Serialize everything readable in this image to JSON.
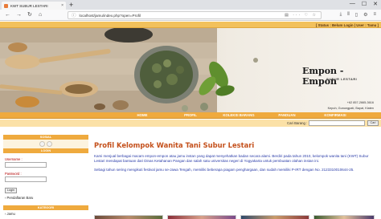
{
  "browser": {
    "tab_title": "KWT SUBUR LESTARI",
    "url": "localhost/jamu/index.php?open=Profil",
    "tab_close": "×",
    "new_tab": "+",
    "win_min": "—",
    "win_max": "☐",
    "win_close": "✕"
  },
  "site": {
    "top_links": "[ Status : Belum Login | User : Tamu ]",
    "brand_name": "Empon - Empon",
    "brand_sub": "SUBUR LESTARI",
    "phone": "+62 857-2665-3616",
    "address": "Kepuh, Gunungpati, Bayat, Klaten",
    "menu": [
      "HOME",
      "PROFIL",
      "KOLEKSI BARANG",
      "PANDUAN",
      "KONFIRMASI"
    ],
    "search_label": "Cari Barang :",
    "search_value": "",
    "search_button": "Cari"
  },
  "sidebar": {
    "social_head": "SOSIAL",
    "login_head": "LOGIN",
    "username_label": "Username :",
    "password_label": "Password :",
    "login_button": "Login",
    "register_link": "› Pendaftaran Baru",
    "kategori_head": "KATEGORI",
    "kategori_item": "› Jamu"
  },
  "main": {
    "title": "Profil Kelompok Wanita Tani Subur Lestari",
    "paragraph1": "Kami menjual berbagai macam empon-empon atau jamu instan yang dapat menyehatkan badan secara alami. Berdiri pada tahun 2010, kelompok wanita tani (KWT) Subur Lestari mendapat bantuan dari Dinas Ketahanan Pangan dan salah satu universitas negeri di Yogyakarta untuk pembuatan olahan instan ini.",
    "paragraph2": "Sebagi tahun sering mengikuti festival jamu se-Jawa Tengah, memiliki beberapa piagam penghargaan, dan sudah memiliki P-IRT dengan No. 2123310010644-25."
  },
  "colors": {
    "accent_orange": "#efaa3e",
    "title_red": "#c4501b",
    "body_blue": "#2a3ca8"
  }
}
